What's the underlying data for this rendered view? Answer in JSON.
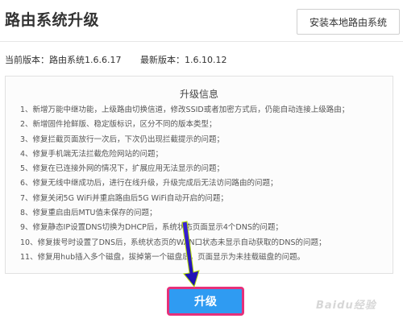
{
  "header": {
    "title": "路由系统升级",
    "install_button": "安装本地路由系统"
  },
  "version": {
    "current_label": "当前版本：路由系统1.6.6.17",
    "latest_label": "最新版本：1.6.10.12"
  },
  "upgrade_info": {
    "title": "升级信息",
    "items": [
      "1、新增万能中继功能，上级路由切换信道，修改SSID或者加密方式后，仍能自动连接上级路由；",
      "2、新增固件抢鲜版、稳定版标识，区分不同的版本类型；",
      "3、修复拦截页面放行一次后，下次仍出现拦截提示的问题；",
      "4、修复手机端无法拦截危险网站的问题；",
      "5、修复在已连接外网的情况下，扩展应用无法显示的问题；",
      "6、修复无线中继成功后，进行在线升级，升级完成后无法访问路由的问题；",
      "7、修复关闭5G WiFi并重启路由后5G WiFi自动开启的问题；",
      "8、修复重启由后MTU值未保存的问题；",
      "9、修复静态IP设置DNS切换为DHCP后，系统状态页面显示4个DNS的问题；",
      "10、修复拨号时设置了DNS后，系统状态页的WAN口状态未显示自动获取的DNS的问题；",
      "11、修复用hub插入多个磁盘，拔掉第一个磁盘后，页面显示为未挂载磁盘的问题。"
    ]
  },
  "actions": {
    "upgrade_button": "升级"
  },
  "watermark": {
    "text": "Baidu经验"
  },
  "colors": {
    "upgrade_bg": "#2f9bf2",
    "highlight_border": "#e6307a",
    "arrow": "#2b18c8"
  }
}
